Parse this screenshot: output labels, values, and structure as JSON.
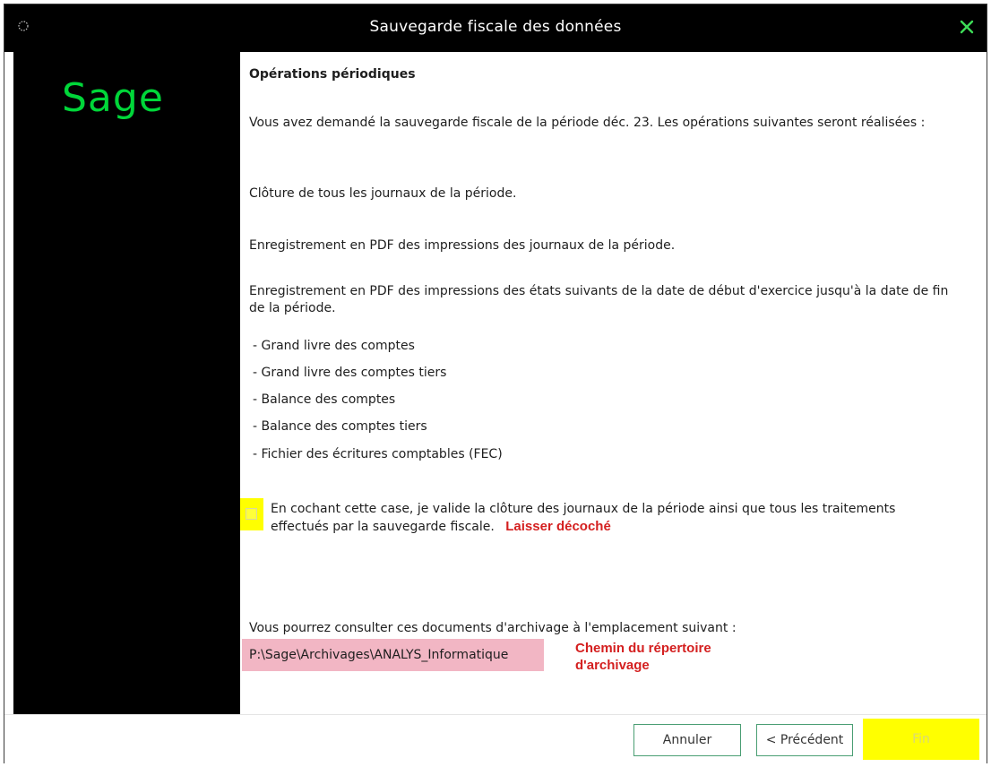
{
  "window": {
    "title": "Sauvegarde fiscale des données",
    "close_icon": "close-icon"
  },
  "sidebar": {
    "logo_text": "Sage",
    "logo_color": "#00d639"
  },
  "content": {
    "heading": "Opérations périodiques",
    "intro": "Vous avez demandé la sauvegarde fiscale de la période déc. 23. Les opérations suivantes seront réalisées :",
    "op1": "Clôture de tous les journaux de la période.",
    "op2": "Enregistrement en PDF des impressions des journaux de la période.",
    "op3": "Enregistrement en PDF des impressions des états suivants de la date de début d'exercice jusqu'à la date de fin de la période.",
    "items": [
      "- Grand livre des comptes",
      "- Grand livre des comptes tiers",
      "- Balance des comptes",
      "- Balance des comptes tiers",
      "- Fichier des écritures comptables (FEC)"
    ],
    "checkbox_label": "En cochant cette case, je valide la clôture des journaux de la période ainsi que tous les traitements effectués par la sauvegarde fiscale.",
    "checkbox_checked": false,
    "checkbox_annotation": "Laisser décoché",
    "location_text": "Vous pourrez consulter ces documents d'archivage à l'emplacement suivant :",
    "archive_path": "P:\\Sage\\Archivages\\ANALYS_Informatique",
    "path_annotation_line1": "Chemin du répertoire",
    "path_annotation_line2": "d'archivage"
  },
  "footer": {
    "cancel_label": "Annuler",
    "previous_label": "< Précédent",
    "finish_label": "Fin"
  },
  "colors": {
    "highlight_yellow": "#ffff00",
    "highlight_pink": "#f2b6c4",
    "annotation_red": "#d41f1f",
    "button_border": "#4a9e73"
  }
}
